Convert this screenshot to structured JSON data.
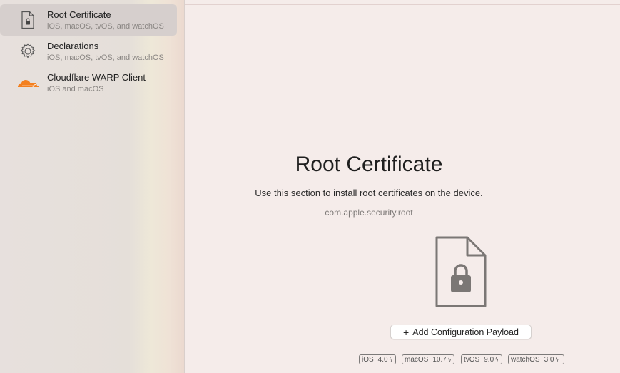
{
  "sidebar": {
    "items": [
      {
        "title": "Root Certificate",
        "subtitle": "iOS, macOS, tvOS, and watchOS",
        "icon": "certificate-document-icon",
        "selected": true
      },
      {
        "title": "Declarations",
        "subtitle": "iOS, macOS, tvOS, and watchOS",
        "icon": "gear-icon",
        "selected": false
      },
      {
        "title": "Cloudflare WARP Client",
        "subtitle": "iOS and macOS",
        "icon": "cloudflare-logo-icon",
        "selected": false
      }
    ]
  },
  "main": {
    "title": "Root Certificate",
    "description": "Use this section to install root certificates on the device.",
    "identifier": "com.apple.security.root",
    "icon": "locked-document-icon",
    "add_button": {
      "plus": "+",
      "label": "Add Configuration Payload"
    },
    "platforms": [
      {
        "name": "iOS",
        "version": "4.0"
      },
      {
        "name": "macOS",
        "version": "10.7"
      },
      {
        "name": "tvOS",
        "version": "9.0"
      },
      {
        "name": "watchOS",
        "version": "3.0"
      }
    ]
  },
  "colors": {
    "accent_orange": "#f38020",
    "selection": "#d6cfcd",
    "background": "#f5ecea"
  }
}
